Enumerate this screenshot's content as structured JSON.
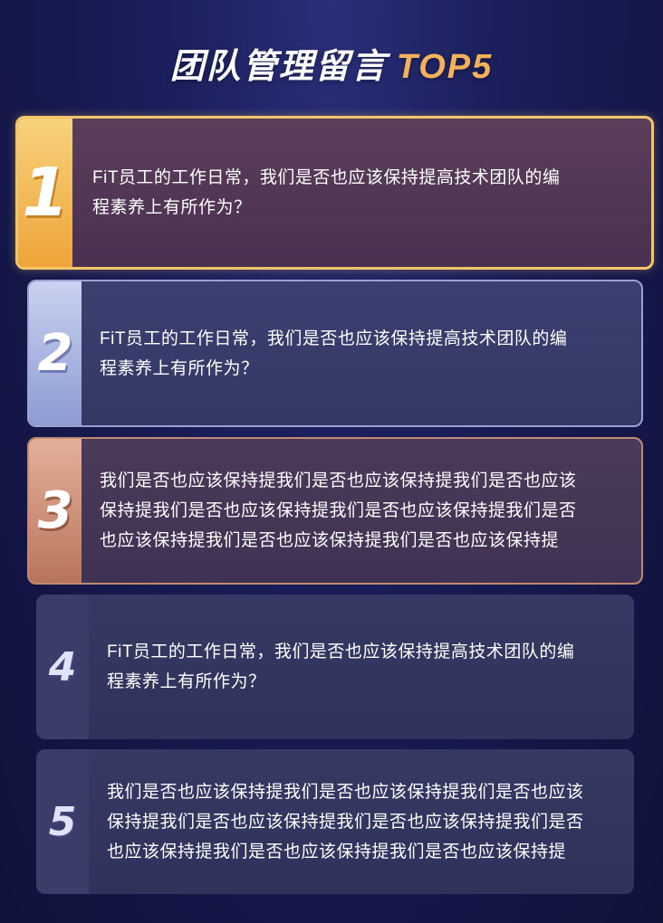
{
  "header": {
    "title": "团队管理留言",
    "title_accent": "TOP5"
  },
  "colors": {
    "gold": "#f3c56a",
    "silver": "#9aa3cf",
    "bronze": "#c08a72",
    "accent_text": "#f3b15a"
  },
  "messages": [
    {
      "rank": "1",
      "lines": [
        "FiT员工的工作日常，我们是否也应该保持提高技术团队的编",
        "程素养上有所作为？"
      ]
    },
    {
      "rank": "2",
      "lines": [
        "FiT员工的工作日常，我们是否也应该保持提高技术团队的编",
        "程素养上有所作为？"
      ]
    },
    {
      "rank": "3",
      "lines": [
        "我们是否也应该保持提我们是否也应该保持提我们是否也应该",
        "保持提我们是否也应该保持提我们是否也应该保持提我们是否",
        "也应该保持提我们是否也应该保持提我们是否也应该保持提"
      ]
    },
    {
      "rank": "4",
      "lines": [
        "FiT员工的工作日常，我们是否也应该保持提高技术团队的编",
        "程素养上有所作为？"
      ]
    },
    {
      "rank": "5",
      "lines": [
        "我们是否也应该保持提我们是否也应该保持提我们是否也应该",
        "保持提我们是否也应该保持提我们是否也应该保持提我们是否",
        "也应该保持提我们是否也应该保持提我们是否也应该保持提"
      ]
    }
  ]
}
